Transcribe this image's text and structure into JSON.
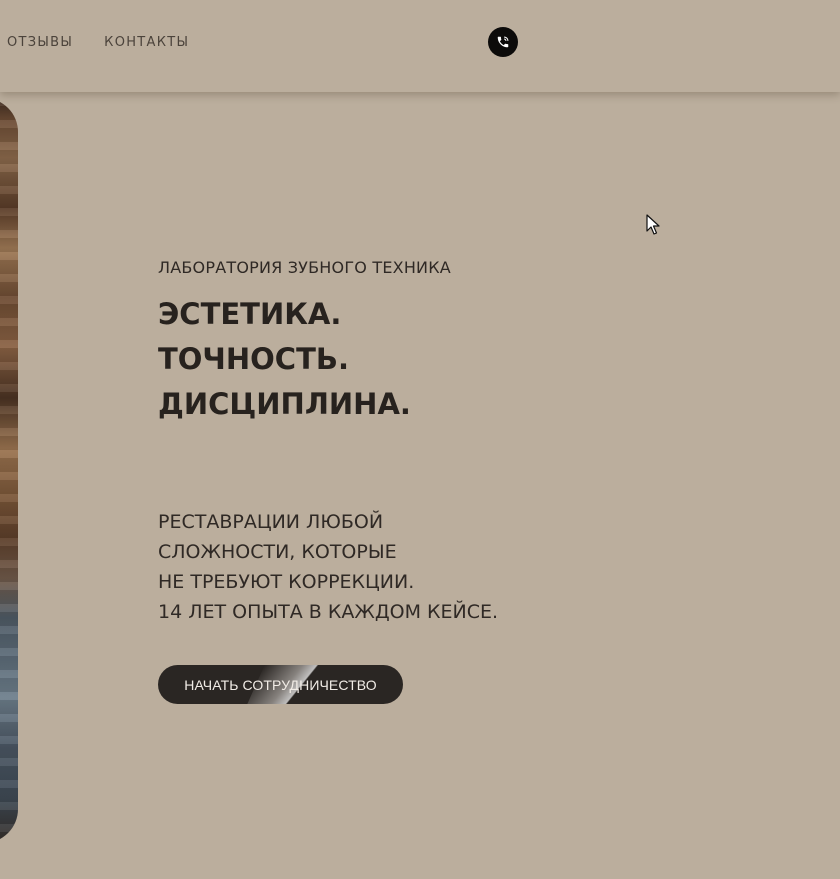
{
  "nav": {
    "items": [
      {
        "label": "ОТЗЫВЫ"
      },
      {
        "label": "КОНТАКТЫ"
      }
    ]
  },
  "header": {
    "phone_icon": "phone-icon"
  },
  "hero": {
    "eyebrow": "ЛАБОРАТОРИЯ ЗУБНОГО ТЕХНИКА",
    "headline": [
      "ЭСТЕТИКА.",
      "ТОЧНОСТЬ.",
      "ДИСЦИПЛИНА."
    ],
    "description": [
      "РЕСТАВРАЦИИ ЛЮБОЙ",
      "СЛОЖНОСТИ, КОТОРЫЕ",
      "НЕ ТРЕБУЮТ КОРРЕКЦИИ.",
      "14 ЛЕТ ОПЫТА В КАЖДОМ КЕЙСЕ."
    ],
    "cta_label": "НАЧАТЬ СОТРУДНИЧЕСТВО"
  },
  "colors": {
    "background": "#bbae9d",
    "text": "#2b2622",
    "button": "#2a2623",
    "button_text": "#f1ece6",
    "phone_button": "#0c0b0a"
  }
}
